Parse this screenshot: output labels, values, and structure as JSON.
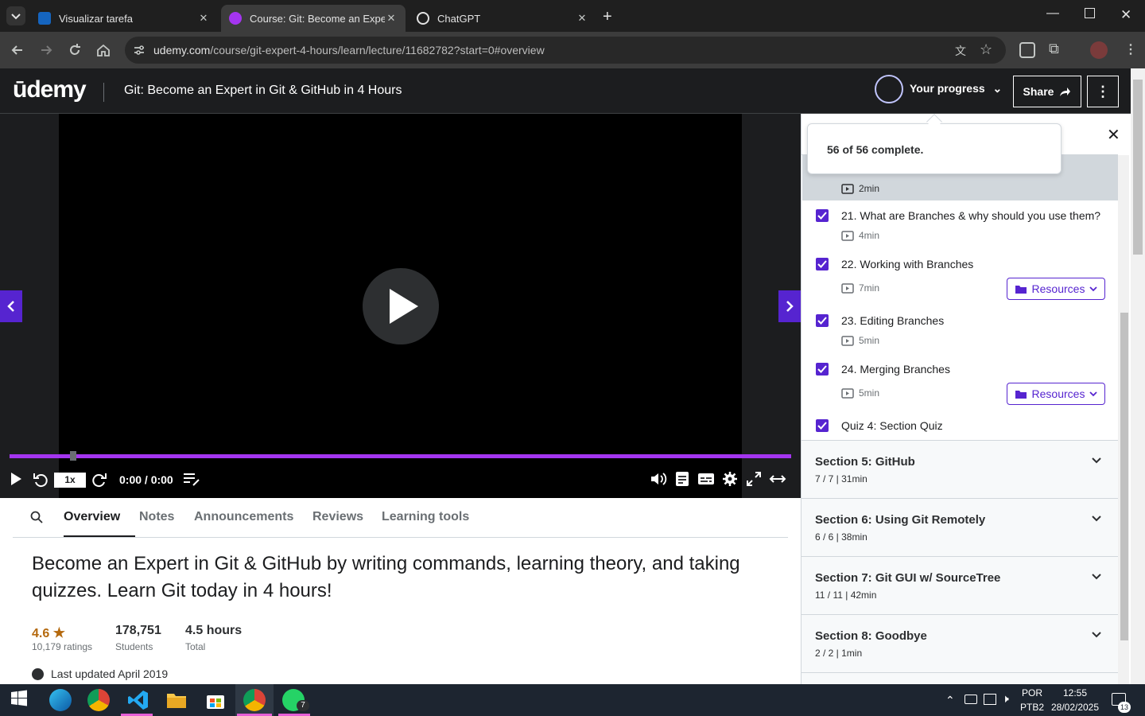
{
  "browser": {
    "tabs": [
      {
        "title": "Visualizar tarefa",
        "active": false
      },
      {
        "title": "Course: Git: Become an Expert i",
        "active": true
      },
      {
        "title": "ChatGPT",
        "active": false
      }
    ],
    "url_main": "udemy.com",
    "url_rest": "/course/git-expert-4-hours/learn/lecture/11682782?start=0#overview"
  },
  "header": {
    "logo": "ūdemy",
    "course_title": "Git: Become an Expert in Git & GitHub in 4 Hours",
    "progress_label": "Your progress",
    "share_label": "Share"
  },
  "popover": {
    "text": "56 of 56 complete."
  },
  "video": {
    "speed": "1x",
    "time": "0:00 / 0:00",
    "progress": 0.08
  },
  "main": {
    "tabs": [
      "Overview",
      "Notes",
      "Announcements",
      "Reviews",
      "Learning tools"
    ],
    "headline": "Become an Expert in Git & GitHub by writing commands, learning theory, and taking quizzes. Learn Git today in 4 hours!",
    "rating": "4.6",
    "ratings_count": "10,179 ratings",
    "students": "178,751",
    "students_label": "Students",
    "hours": "4.5 hours",
    "hours_label": "Total",
    "updated": "Last updated April 2019"
  },
  "sidebar": {
    "current_duration": "2min",
    "lectures": [
      {
        "title": "21. What are Branches & why should you use them?",
        "duration": "4min",
        "resources": false
      },
      {
        "title": "22. Working with Branches",
        "duration": "7min",
        "resources": true
      },
      {
        "title": "23. Editing Branches",
        "duration": "5min",
        "resources": false
      },
      {
        "title": "24. Merging Branches",
        "duration": "5min",
        "resources": true
      },
      {
        "title": "Quiz 4: Section Quiz",
        "duration": "",
        "resources": false
      }
    ],
    "resources_label": "Resources",
    "sections": [
      {
        "title": "Section 5: GitHub",
        "meta": "7 / 7 | 31min"
      },
      {
        "title": "Section 6: Using Git Remotely",
        "meta": "6 / 6 | 38min"
      },
      {
        "title": "Section 7: Git GUI w/ SourceTree",
        "meta": "11 / 11 | 42min"
      },
      {
        "title": "Section 8: Goodbye",
        "meta": "2 / 2 | 1min"
      }
    ]
  },
  "taskbar": {
    "lang": "POR",
    "layout": "PTB2",
    "time": "12:55",
    "date": "28/02/2025",
    "whatsapp_badge": "7",
    "notif_badge": "13"
  },
  "colors": {
    "accent": "#5624d0",
    "seek": "#a435f0",
    "dark": "#1c1d1f"
  }
}
